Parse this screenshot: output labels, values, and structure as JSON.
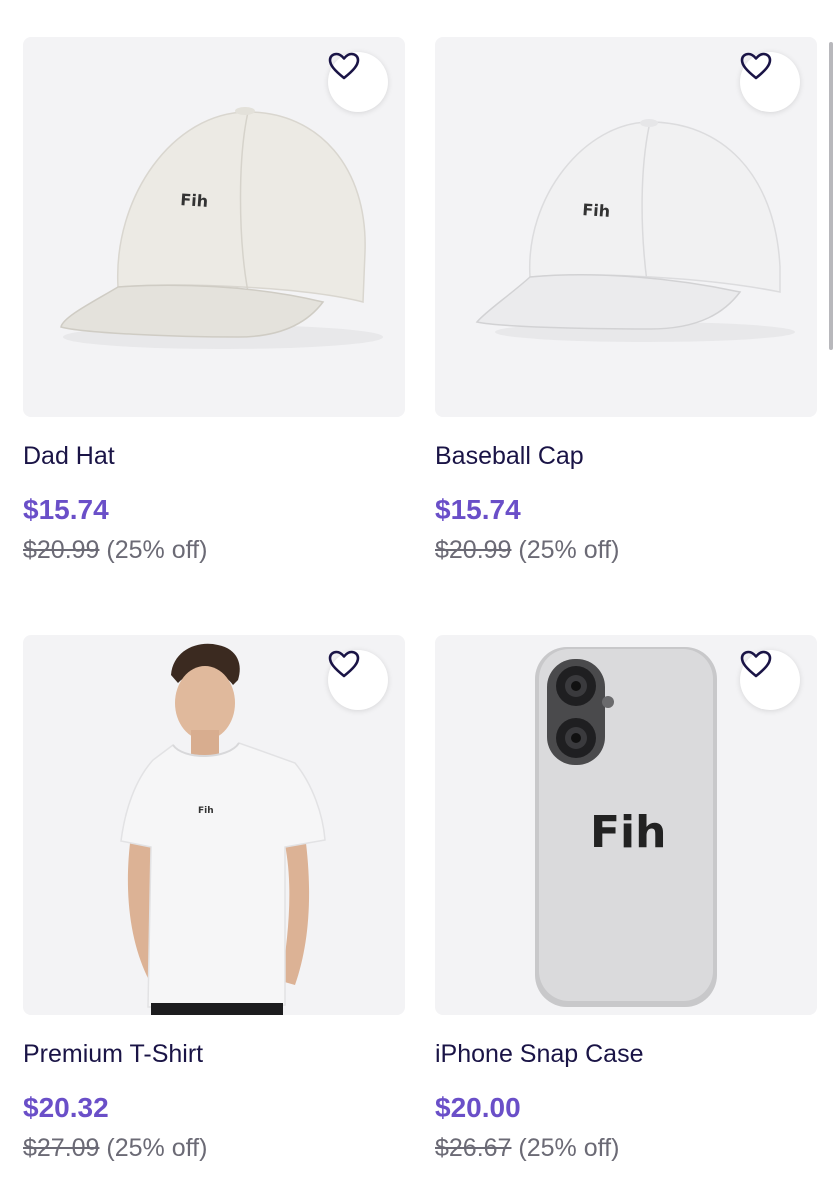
{
  "products": [
    {
      "title": "Dad Hat",
      "price": "$15.74",
      "old_price": "$20.99",
      "discount": "(25% off)",
      "print_text": "Fih",
      "image": "white-dad-hat",
      "icon": "heart-icon"
    },
    {
      "title": "Baseball Cap",
      "price": "$15.74",
      "old_price": "$20.99",
      "discount": "(25% off)",
      "print_text": "Fih",
      "image": "white-baseball-cap",
      "icon": "heart-icon"
    },
    {
      "title": "Premium T-Shirt",
      "price": "$20.32",
      "old_price": "$27.09",
      "discount": "(25% off)",
      "print_text": "Fih",
      "image": "man-in-white-tshirt",
      "icon": "heart-icon"
    },
    {
      "title": "iPhone Snap Case",
      "price": "$20.00",
      "old_price": "$26.67",
      "discount": "(25% off)",
      "print_text": "Fih",
      "image": "grey-iphone-case",
      "icon": "heart-icon"
    }
  ],
  "colors": {
    "title": "#1a1446",
    "price": "#6a4fc8",
    "old_price": "#6b6a75",
    "image_bg": "#f3f3f5"
  }
}
